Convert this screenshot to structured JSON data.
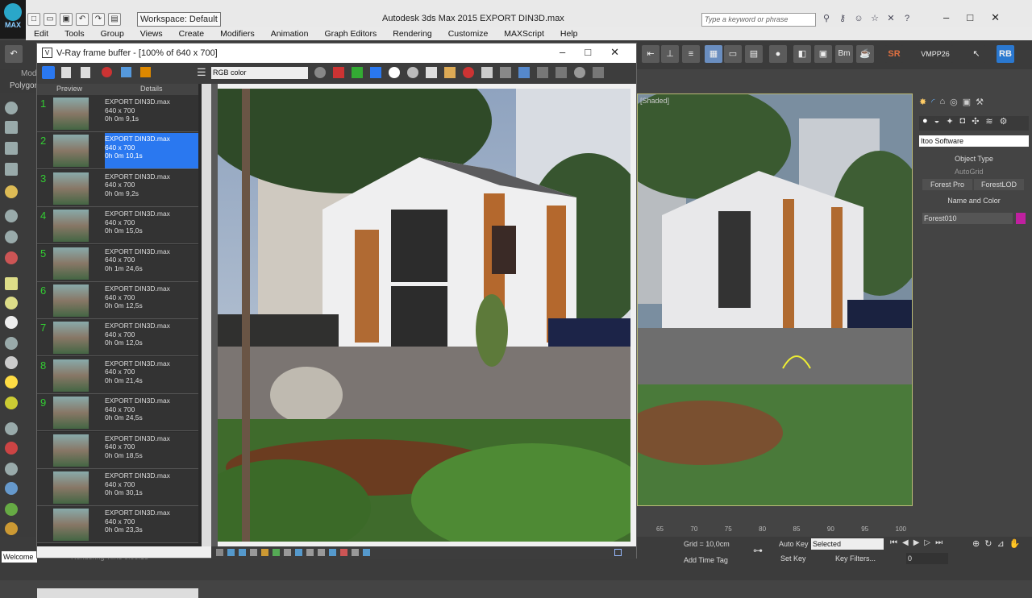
{
  "app": {
    "title": "Autodesk 3ds Max  2015    EXPORT DIN3D.max",
    "logo": "MAX",
    "workspace": "Workspace: Default",
    "search_placeholder": "Type a keyword or phrase"
  },
  "menu": [
    "Edit",
    "Tools",
    "Group",
    "Views",
    "Create",
    "Modifiers",
    "Animation",
    "Graph Editors",
    "Rendering",
    "Customize",
    "MAXScript",
    "Help"
  ],
  "ribbon": {
    "tab1": "Mod",
    "tab2": "Polygon"
  },
  "main_toolbar_right": {
    "sr": "SR",
    "vmpp": "VMPP26",
    "rb": "RB"
  },
  "vfb": {
    "title": "V-Ray frame buffer - [100% of 640 x 700]",
    "channel": "RGB color",
    "history_headers": {
      "preview": "Preview",
      "details": "Details"
    },
    "history": [
      {
        "num": "1",
        "name": "EXPORT DIN3D.max",
        "size": "640 x 700",
        "time": "0h 0m 9,1s"
      },
      {
        "num": "2",
        "name": "EXPORT DIN3D.max",
        "size": "640 x 700",
        "time": "0h 0m 10,1s",
        "selected": true
      },
      {
        "num": "3",
        "name": "EXPORT DIN3D.max",
        "size": "640 x 700",
        "time": "0h 0m 9,2s"
      },
      {
        "num": "4",
        "name": "EXPORT DIN3D.max",
        "size": "640 x 700",
        "time": "0h 0m 15,0s"
      },
      {
        "num": "5",
        "name": "EXPORT DIN3D.max",
        "size": "640 x 700",
        "time": "0h 1m 24,6s"
      },
      {
        "num": "6",
        "name": "EXPORT DIN3D.max",
        "size": "640 x 700",
        "time": "0h 0m 12,5s"
      },
      {
        "num": "7",
        "name": "EXPORT DIN3D.max",
        "size": "640 x 700",
        "time": "0h 0m 12,0s"
      },
      {
        "num": "8",
        "name": "EXPORT DIN3D.max",
        "size": "640 x 700",
        "time": "0h 0m 21,4s"
      },
      {
        "num": "9",
        "name": "EXPORT DIN3D.max",
        "size": "640 x 700",
        "time": "0h 0m 24,5s"
      },
      {
        "num": "",
        "name": "EXPORT DIN3D.max",
        "size": "640 x 700",
        "time": "0h 0m 18,5s"
      },
      {
        "num": "",
        "name": "EXPORT DIN3D.max",
        "size": "640 x 700",
        "time": "0h 0m 30,1s"
      },
      {
        "num": "",
        "name": "EXPORT DIN3D.max",
        "size": "640 x 700",
        "time": "0h 0m 23,3s"
      }
    ]
  },
  "viewport": {
    "label": "[Shaded]"
  },
  "cmdpanel": {
    "dropdown": "Itoo Software",
    "object_type": "Object Type",
    "autogrid": "AutoGrid",
    "btn1": "Forest Pro",
    "btn2": "ForestLOD",
    "name_color": "Name and Color",
    "name_value": "Forest010",
    "swatch_color": "#c020a0"
  },
  "timeline": {
    "ticks": [
      "65",
      "70",
      "75",
      "80",
      "85",
      "90",
      "95",
      "100"
    ]
  },
  "status": {
    "welcome": "Welcome",
    "rendering_time": "Rendering Time 0:00:18",
    "grid": "Grid = 10,0cm",
    "add_time_tag": "Add Time Tag",
    "auto_key": "Auto Key",
    "selected": "Selected",
    "set_key": "Set Key",
    "key_filters": "Key Filters...",
    "frame": "0"
  }
}
